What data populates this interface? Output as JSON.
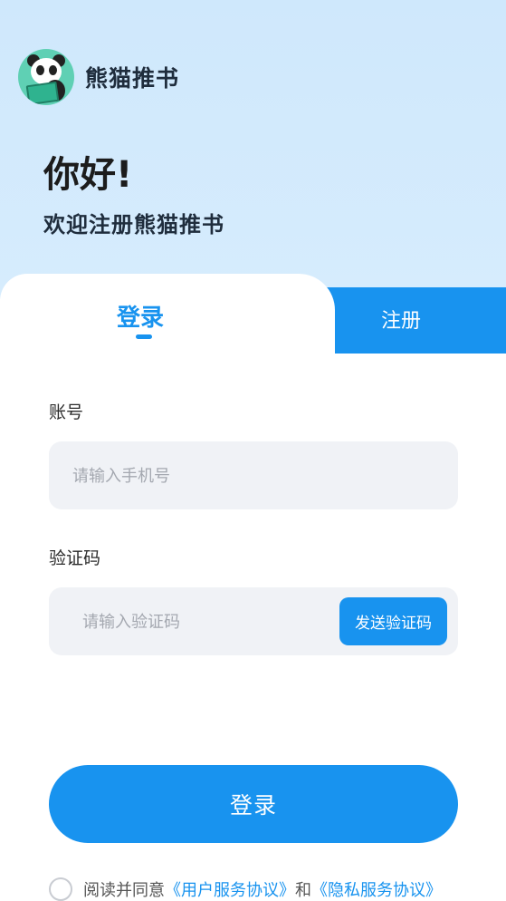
{
  "brand": {
    "name": "熊猫推书",
    "logo_icon": "panda-reading-logo"
  },
  "header": {
    "greeting": "你好!",
    "subtitle": "欢迎注册熊猫推书"
  },
  "tabs": {
    "login": "登录",
    "register": "注册",
    "active": "login"
  },
  "form": {
    "account_label": "账号",
    "account_placeholder": "请输入手机号",
    "code_label": "验证码",
    "code_placeholder": "请输入验证码",
    "send_code": "发送验证码"
  },
  "submit_label": "登录",
  "agreement": {
    "prefix": "阅读并同意",
    "link1": "《用户服务协议》",
    "middle": "和",
    "link2": "《隐私服务协议》"
  },
  "colors": {
    "accent": "#1893ef",
    "top_bg": "#cfe8fc",
    "field_bg": "#f0f2f6"
  }
}
